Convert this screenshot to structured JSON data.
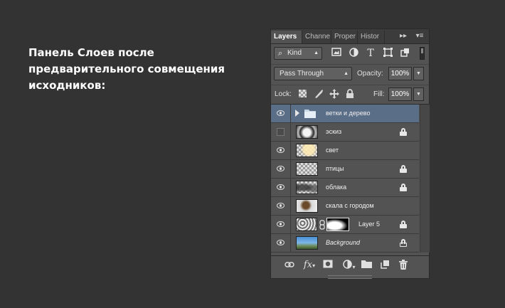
{
  "caption": {
    "line1": "Панель Слоев после",
    "line2": "предварительного совмещения",
    "line3": "исходников:"
  },
  "panel": {
    "tabs": [
      {
        "label": "Layers",
        "active": true
      },
      {
        "label": "Channe",
        "active": false
      },
      {
        "label": "Proper",
        "active": false
      },
      {
        "label": "Histor",
        "active": false
      }
    ],
    "tab_more": "▸▸",
    "panel_menu": "▾≡",
    "filter": {
      "kind_label": "Kind",
      "icons": [
        "image-filter-icon",
        "adjustment-filter-icon",
        "type-filter-icon",
        "shape-filter-icon",
        "smart-object-filter-icon"
      ]
    },
    "blend_mode": "Pass Through",
    "opacity_label": "Opacity:",
    "opacity_value": "100%",
    "lock_label": "Lock:",
    "fill_label": "Fill:",
    "fill_value": "100%",
    "layers": [
      {
        "name": "ветки и дерево",
        "visible": true,
        "type": "group",
        "selected": true,
        "locked": false
      },
      {
        "name": "эскиз",
        "visible": false,
        "type": "image",
        "selected": false,
        "locked": true
      },
      {
        "name": "свет",
        "visible": true,
        "type": "image",
        "selected": false,
        "locked": false
      },
      {
        "name": "птицы",
        "visible": true,
        "type": "image",
        "selected": false,
        "locked": true
      },
      {
        "name": "облака",
        "visible": true,
        "type": "image",
        "selected": false,
        "locked": true
      },
      {
        "name": "скала с городом",
        "visible": true,
        "type": "image",
        "selected": false,
        "locked": false
      },
      {
        "name": "Layer 5",
        "visible": true,
        "type": "masked",
        "selected": false,
        "locked": true
      },
      {
        "name": "Background",
        "visible": true,
        "type": "background",
        "selected": false,
        "locked": true
      }
    ],
    "bottom_icons": [
      "link-layers-icon",
      "fx-icon",
      "add-mask-icon",
      "adjustment-layer-icon",
      "new-group-icon",
      "new-layer-icon",
      "delete-layer-icon"
    ],
    "fx_label": "fx"
  }
}
